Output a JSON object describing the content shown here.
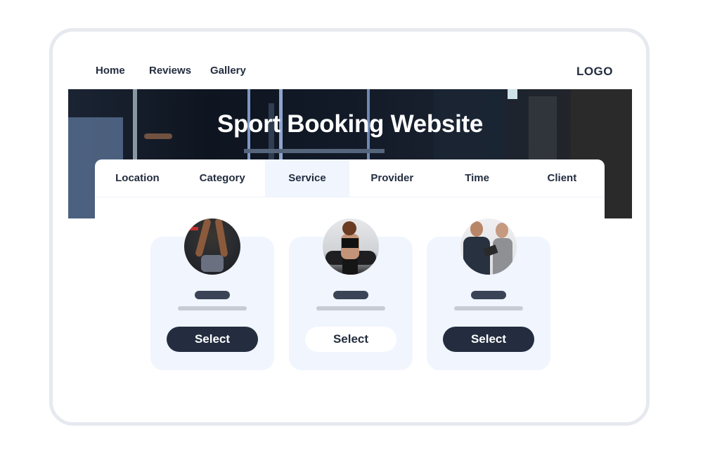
{
  "nav": {
    "links": [
      "Home",
      "Reviews",
      "Gallery"
    ],
    "logo": "LOGO"
  },
  "hero": {
    "title": "Sport Booking Website"
  },
  "tabs": [
    {
      "label": "Location",
      "active": false
    },
    {
      "label": "Category",
      "active": false
    },
    {
      "label": "Service",
      "active": true
    },
    {
      "label": "Provider",
      "active": false
    },
    {
      "label": "Time",
      "active": false
    },
    {
      "label": "Client",
      "active": false
    }
  ],
  "cards": [
    {
      "image": "man-lifting-kettlebell",
      "button_label": "Select",
      "button_style": "dark"
    },
    {
      "image": "woman-on-treadmill",
      "button_label": "Select",
      "button_style": "light"
    },
    {
      "image": "trainer-with-client-tablet",
      "button_label": "Select",
      "button_style": "dark"
    }
  ],
  "colors": {
    "primary": "#232d3f",
    "card_bg": "#f0f5fe",
    "frame": "#e6e9ee",
    "placeholder_dark": "#3a4456",
    "placeholder_light": "#c7ccd4"
  }
}
